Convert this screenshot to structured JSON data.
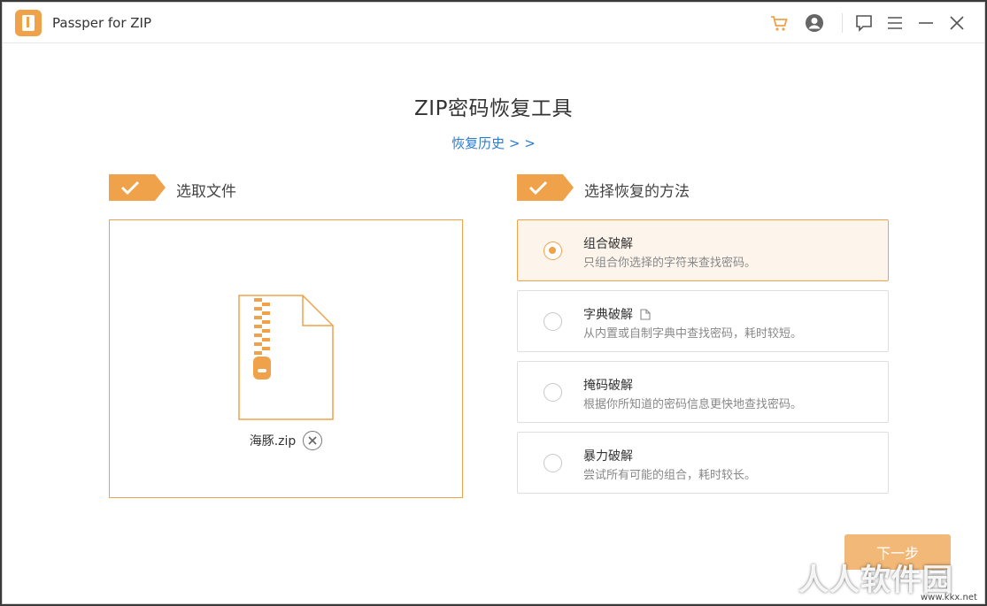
{
  "window": {
    "title": "Passper for ZIP",
    "icons": [
      "cart-icon",
      "account-icon",
      "feedback-icon",
      "menu-icon",
      "minimize-icon",
      "close-icon"
    ]
  },
  "main": {
    "title": "ZIP密码恢复工具",
    "history_link": "恢复历史 > >"
  },
  "step1": {
    "label": "选取文件"
  },
  "file": {
    "name": "海豚.zip"
  },
  "step2": {
    "label": "选择恢复的方法"
  },
  "methods": [
    {
      "title": "组合破解",
      "desc": "只组合你选择的字符来查找密码。",
      "selected": true
    },
    {
      "title": "字典破解",
      "desc": "从内置或自制字典中查找密码，耗时较短。",
      "selected": false,
      "has_icon": "document-icon"
    },
    {
      "title": "掩码破解",
      "desc": "根据你所知道的密码信息更快地查找密码。",
      "selected": false
    },
    {
      "title": "暴力破解",
      "desc": "尝试所有可能的组合，耗时较长。",
      "selected": false
    }
  ],
  "next_button": {
    "label": "下一步"
  },
  "watermark": {
    "text": "人人软件园",
    "url": "www.kkx.net"
  },
  "colors": {
    "accent": "#f0a24a",
    "link": "#2d7ccf",
    "selected_bg": "#fdf4ec",
    "button_bg": "#f2b877"
  }
}
